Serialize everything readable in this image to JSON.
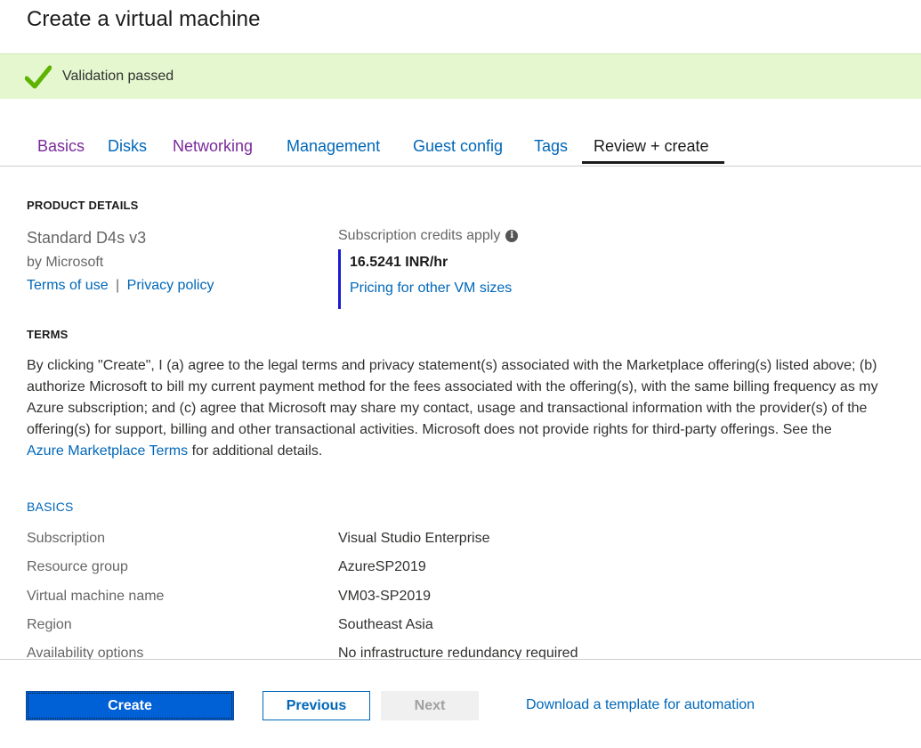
{
  "page": {
    "title": "Create a virtual machine"
  },
  "banner": {
    "message": "Validation passed",
    "icon": "checkmark-icon"
  },
  "tabs": [
    {
      "label": "Basics",
      "state": "visited"
    },
    {
      "label": "Disks",
      "state": "unvisited"
    },
    {
      "label": "Networking",
      "state": "visited"
    },
    {
      "label": "Management",
      "state": "unvisited"
    },
    {
      "label": "Guest config",
      "state": "unvisited"
    },
    {
      "label": "Tags",
      "state": "unvisited"
    },
    {
      "label": "Review + create",
      "state": "active"
    }
  ],
  "product": {
    "heading": "PRODUCT DETAILS",
    "name": "Standard D4s v3",
    "publisher": "by Microsoft",
    "terms_link": "Terms of use",
    "separator": "|",
    "privacy_link": "Privacy policy",
    "credits_label": "Subscription credits apply",
    "info_icon": "i",
    "price": "16.5241 INR/hr",
    "pricing_link": "Pricing for other VM sizes"
  },
  "terms": {
    "heading": "TERMS",
    "text": "By clicking \"Create\", I (a) agree to the legal terms and privacy statement(s) associated with the Marketplace offering(s) listed above; (b) authorize Microsoft to bill my current payment method for the fees associated with the offering(s), with the same billing frequency as my Azure subscription; and (c) agree that Microsoft may share my contact, usage and transactional information with the provider(s) of the offering(s) for support, billing and other transactional activities. Microsoft does not provide rights for third-party offerings. See the",
    "link": "Azure Marketplace Terms",
    "suffix": "for additional details."
  },
  "basics": {
    "heading": "BASICS",
    "rows": [
      {
        "label": "Subscription",
        "value": "Visual Studio Enterprise"
      },
      {
        "label": "Resource group",
        "value": "AzureSP2019"
      },
      {
        "label": "Virtual machine name",
        "value": "VM03-SP2019"
      },
      {
        "label": "Region",
        "value": "Southeast Asia"
      },
      {
        "label": "Availability options",
        "value": "No infrastructure redundancy required"
      }
    ]
  },
  "footer": {
    "create": "Create",
    "previous": "Previous",
    "next": "Next",
    "download_link": "Download a template for automation"
  },
  "colors": {
    "accent": "#0067b8",
    "visited": "#7a2a9a",
    "success_bg": "#e4f7cf",
    "success_check": "#5db300",
    "primary_button": "#0060d6"
  }
}
